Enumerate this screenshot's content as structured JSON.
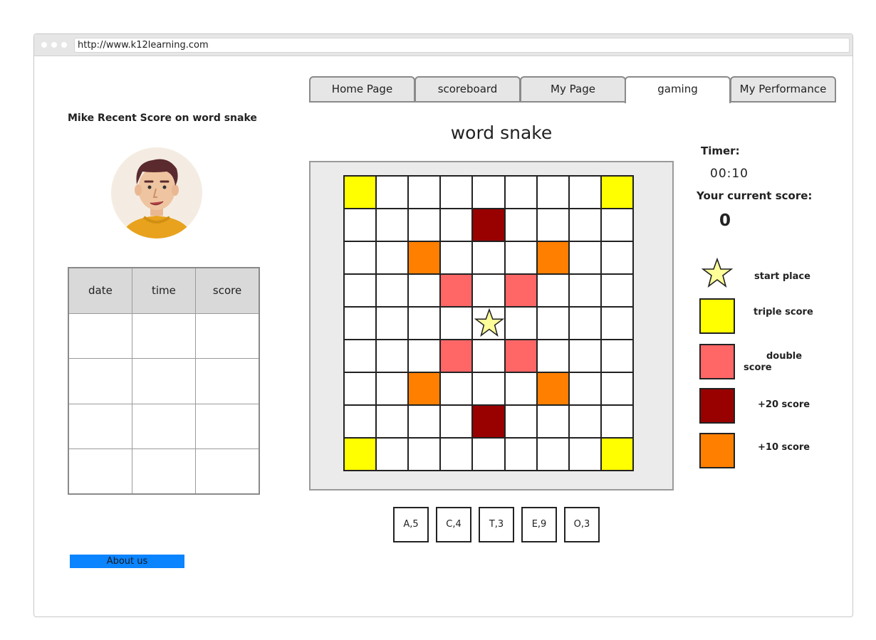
{
  "browser": {
    "url": "http://www.k12learning.com"
  },
  "nav": {
    "tabs": [
      {
        "label": "Home Page",
        "active": false
      },
      {
        "label": "scoreboard",
        "active": false
      },
      {
        "label": "My Page",
        "active": false
      },
      {
        "label": "gaming",
        "active": true
      },
      {
        "label": "My Performance",
        "active": false
      }
    ]
  },
  "left_panel": {
    "title": "Mike Recent Score on word snake",
    "table": {
      "headers": [
        "date",
        "time",
        "score"
      ],
      "rows": [
        [
          "",
          "",
          ""
        ],
        [
          "",
          "",
          ""
        ],
        [
          "",
          "",
          ""
        ],
        [
          "",
          "",
          ""
        ]
      ]
    },
    "about_label": "About us"
  },
  "game": {
    "title": "word snake",
    "board": {
      "rows": 9,
      "cols": 9,
      "special_cells": [
        {
          "row": 0,
          "col": 0,
          "kind": "triple"
        },
        {
          "row": 0,
          "col": 8,
          "kind": "triple"
        },
        {
          "row": 8,
          "col": 0,
          "kind": "triple"
        },
        {
          "row": 8,
          "col": 8,
          "kind": "triple"
        },
        {
          "row": 1,
          "col": 4,
          "kind": "plus20"
        },
        {
          "row": 7,
          "col": 4,
          "kind": "plus20"
        },
        {
          "row": 2,
          "col": 2,
          "kind": "plus10"
        },
        {
          "row": 2,
          "col": 6,
          "kind": "plus10"
        },
        {
          "row": 6,
          "col": 2,
          "kind": "plus10"
        },
        {
          "row": 6,
          "col": 6,
          "kind": "plus10"
        },
        {
          "row": 3,
          "col": 3,
          "kind": "double"
        },
        {
          "row": 3,
          "col": 5,
          "kind": "double"
        },
        {
          "row": 5,
          "col": 3,
          "kind": "double"
        },
        {
          "row": 5,
          "col": 5,
          "kind": "double"
        }
      ],
      "start": {
        "row": 4,
        "col": 4
      }
    },
    "tiles": [
      "A,5",
      "C,4",
      "T,3",
      "E,9",
      "O,3"
    ]
  },
  "status": {
    "timer_label": "Timer:",
    "timer_value": "00:10",
    "score_label": "Your current score:",
    "score_value": "0"
  },
  "legend": {
    "start_label": "start place",
    "triple_label": "triple score",
    "double_label": "double score",
    "plus20_label": "+20 score",
    "plus10_label": "+10 score"
  },
  "colors": {
    "triple": "#ffff00",
    "double": "#ff6666",
    "plus20": "#990000",
    "plus10": "#ff7f00",
    "start_star": "#ffff99",
    "about_button": "#0a84ff"
  },
  "icons": {
    "start": "star-icon",
    "avatar": "user-avatar-illustration"
  }
}
